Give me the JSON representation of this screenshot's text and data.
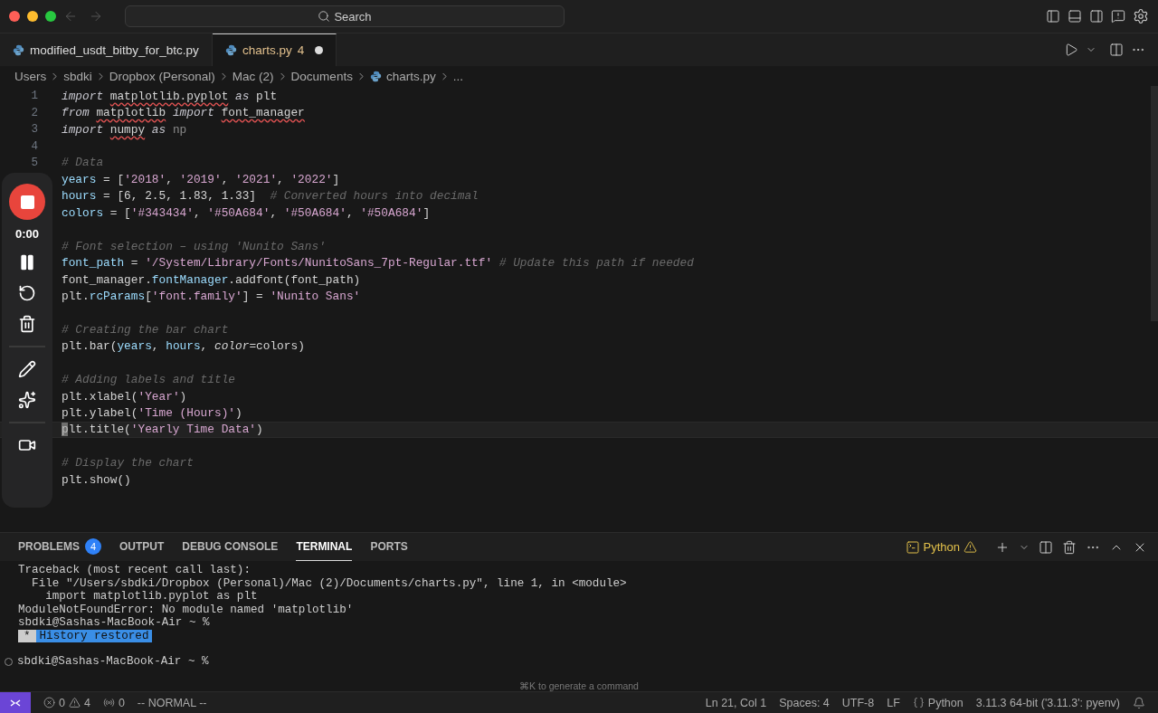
{
  "title_bar": {
    "search": {
      "placeholder": "Search"
    }
  },
  "tabs": [
    {
      "label": "modified_usdt_bitby_for_btc.py",
      "selected": false,
      "dirty": false
    },
    {
      "label": "charts.py",
      "problems": "4",
      "selected": true,
      "dirty": true
    }
  ],
  "breadcrumb": [
    {
      "label": "Users"
    },
    {
      "label": "sbdki"
    },
    {
      "label": "Dropbox (Personal)"
    },
    {
      "label": "Mac (2)"
    },
    {
      "label": "Documents"
    },
    {
      "label": "charts.py",
      "file": true
    },
    {
      "label": "..."
    }
  ],
  "editor": {
    "lines": [
      {
        "kind": "code",
        "number": "1",
        "tokens": [
          {
            "kind": "kw",
            "text": "import "
          },
          {
            "kind": "err",
            "text": "matplotlib.pyplot"
          },
          {
            "kind": "kw",
            "text": " as"
          },
          {
            "kind": "plain",
            "text": " plt"
          }
        ]
      },
      {
        "kind": "code",
        "number": "2",
        "tokens": [
          {
            "kind": "kw",
            "text": "from "
          },
          {
            "kind": "err",
            "text": "matplotlib"
          },
          {
            "kind": "kw",
            "text": " import "
          },
          {
            "kind": "err",
            "text": "font_manager"
          }
        ]
      },
      {
        "kind": "code",
        "number": "3",
        "tokens": [
          {
            "kind": "kw",
            "text": "import "
          },
          {
            "kind": "err",
            "text": "numpy"
          },
          {
            "kind": "kw",
            "text": " as"
          },
          {
            "kind": "dim",
            "text": " np"
          }
        ]
      },
      {
        "kind": "blank",
        "number": "4"
      },
      {
        "kind": "code",
        "number": "5",
        "tokens": [
          {
            "kind": "com",
            "text": "# Data"
          }
        ]
      },
      {
        "kind": "code",
        "tokens": [
          {
            "kind": "var",
            "text": "years"
          },
          {
            "kind": "plain",
            "text": " = ["
          },
          {
            "kind": "str",
            "text": "'2018'"
          },
          {
            "kind": "plain",
            "text": ", "
          },
          {
            "kind": "str",
            "text": "'2019'"
          },
          {
            "kind": "plain",
            "text": ", "
          },
          {
            "kind": "str",
            "text": "'2021'"
          },
          {
            "kind": "plain",
            "text": ", "
          },
          {
            "kind": "str",
            "text": "'2022'"
          },
          {
            "kind": "plain",
            "text": "]"
          }
        ]
      },
      {
        "kind": "code",
        "tokens": [
          {
            "kind": "var",
            "text": "hours"
          },
          {
            "kind": "plain",
            "text": " = [6, 2.5, 1.83, 1.33]  "
          },
          {
            "kind": "com",
            "text": "# Converted hours into decimal"
          }
        ]
      },
      {
        "kind": "code",
        "tokens": [
          {
            "kind": "var",
            "text": "colors"
          },
          {
            "kind": "plain",
            "text": " = ["
          },
          {
            "kind": "str",
            "text": "'#343434'"
          },
          {
            "kind": "plain",
            "text": ", "
          },
          {
            "kind": "str",
            "text": "'#50A684'"
          },
          {
            "kind": "plain",
            "text": ", "
          },
          {
            "kind": "str",
            "text": "'#50A684'"
          },
          {
            "kind": "plain",
            "text": ", "
          },
          {
            "kind": "str",
            "text": "'#50A684'"
          },
          {
            "kind": "plain",
            "text": "]"
          }
        ]
      },
      {
        "kind": "blank"
      },
      {
        "kind": "code",
        "tokens": [
          {
            "kind": "com",
            "text": "# Font selection – using 'Nunito Sans'"
          }
        ]
      },
      {
        "kind": "code",
        "tokens": [
          {
            "kind": "var",
            "text": "font_path"
          },
          {
            "kind": "plain",
            "text": " = "
          },
          {
            "kind": "str",
            "text": "'/System/Library/Fonts/NunitoSans_7pt-Regular.ttf'"
          },
          {
            "kind": "com",
            "text": " # Update this path if needed"
          }
        ]
      },
      {
        "kind": "code",
        "tokens": [
          {
            "kind": "plain",
            "text": "font_manager."
          },
          {
            "kind": "var",
            "text": "fontManager"
          },
          {
            "kind": "plain",
            "text": ".addfont(font_path)"
          }
        ]
      },
      {
        "kind": "code",
        "tokens": [
          {
            "kind": "plain",
            "text": "plt."
          },
          {
            "kind": "var",
            "text": "rcParams"
          },
          {
            "kind": "plain",
            "text": "["
          },
          {
            "kind": "str",
            "text": "'font.family'"
          },
          {
            "kind": "plain",
            "text": "] = "
          },
          {
            "kind": "str",
            "text": "'Nunito Sans'"
          }
        ]
      },
      {
        "kind": "blank"
      },
      {
        "kind": "code",
        "tokens": [
          {
            "kind": "com",
            "text": "# Creating the bar chart"
          }
        ]
      },
      {
        "kind": "code",
        "tokens": [
          {
            "kind": "plain",
            "text": "plt.bar("
          },
          {
            "kind": "var",
            "text": "years"
          },
          {
            "kind": "plain",
            "text": ", "
          },
          {
            "kind": "var",
            "text": "hours"
          },
          {
            "kind": "plain",
            "text": ", "
          },
          {
            "kind": "param",
            "text": "color"
          },
          {
            "kind": "plain",
            "text": "=colors)"
          }
        ]
      },
      {
        "kind": "blank"
      },
      {
        "kind": "code",
        "tokens": [
          {
            "kind": "com",
            "text": "# Adding labels and title"
          }
        ]
      },
      {
        "kind": "code",
        "tokens": [
          {
            "kind": "plain",
            "text": "plt.xlabel("
          },
          {
            "kind": "str",
            "text": "'Year'"
          },
          {
            "kind": "plain",
            "text": ")"
          }
        ]
      },
      {
        "kind": "code",
        "tokens": [
          {
            "kind": "plain",
            "text": "plt.ylabel("
          },
          {
            "kind": "str",
            "text": "'Time (Hours)'"
          },
          {
            "kind": "plain",
            "text": ")"
          }
        ]
      },
      {
        "kind": "code",
        "current": true,
        "tokens": [
          {
            "kind": "plain",
            "text": "plt.title("
          },
          {
            "kind": "str",
            "text": "'Yearly Time Data'"
          },
          {
            "kind": "plain",
            "text": ")"
          }
        ]
      },
      {
        "kind": "blank"
      },
      {
        "kind": "code",
        "tokens": [
          {
            "kind": "com",
            "text": "# Display the chart"
          }
        ]
      },
      {
        "kind": "code",
        "tokens": [
          {
            "kind": "plain",
            "text": "plt.show()"
          }
        ]
      }
    ]
  },
  "recorder": {
    "time": "0:00"
  },
  "panel": {
    "tabs": [
      {
        "label": "PROBLEMS",
        "count": "4",
        "selected": false
      },
      {
        "label": "OUTPUT",
        "selected": false
      },
      {
        "label": "DEBUG CONSOLE",
        "selected": false
      },
      {
        "label": "TERMINAL",
        "selected": true
      },
      {
        "label": "PORTS",
        "selected": false
      }
    ],
    "shell": "Python",
    "terminal": [
      {
        "kind": "text",
        "text": "Traceback (most recent call last):"
      },
      {
        "kind": "text",
        "text": "  File \"/Users/sbdki/Dropbox (Personal)/Mac (2)/Documents/charts.py\", line 1, in <module>"
      },
      {
        "kind": "text",
        "text": "    import matplotlib.pyplot as plt"
      },
      {
        "kind": "text",
        "text": "ModuleNotFoundError: No module named 'matplotlib'"
      },
      {
        "kind": "text",
        "text": "sbdki@Sashas-MacBook-Air ~ %"
      },
      {
        "kind": "badge",
        "mark": "*",
        "text": "History restored"
      },
      {
        "kind": "prompt",
        "text": "sbdki@Sashas-MacBook-Air ~ %"
      }
    ],
    "hint": "⌘K to generate a command"
  },
  "status_bar": {
    "errors": "0",
    "warnings": "4",
    "ports": "0",
    "mode": "-- NORMAL --",
    "right": [
      {
        "kind": "text",
        "text": "Ln 21, Col 1"
      },
      {
        "kind": "text",
        "text": "Spaces: 4"
      },
      {
        "kind": "text",
        "text": "UTF-8"
      },
      {
        "kind": "text",
        "text": "LF"
      },
      {
        "kind": "language",
        "text": "Python"
      },
      {
        "kind": "text",
        "text": "3.11.3 64-bit ('3.11.3': pyenv)"
      }
    ]
  }
}
